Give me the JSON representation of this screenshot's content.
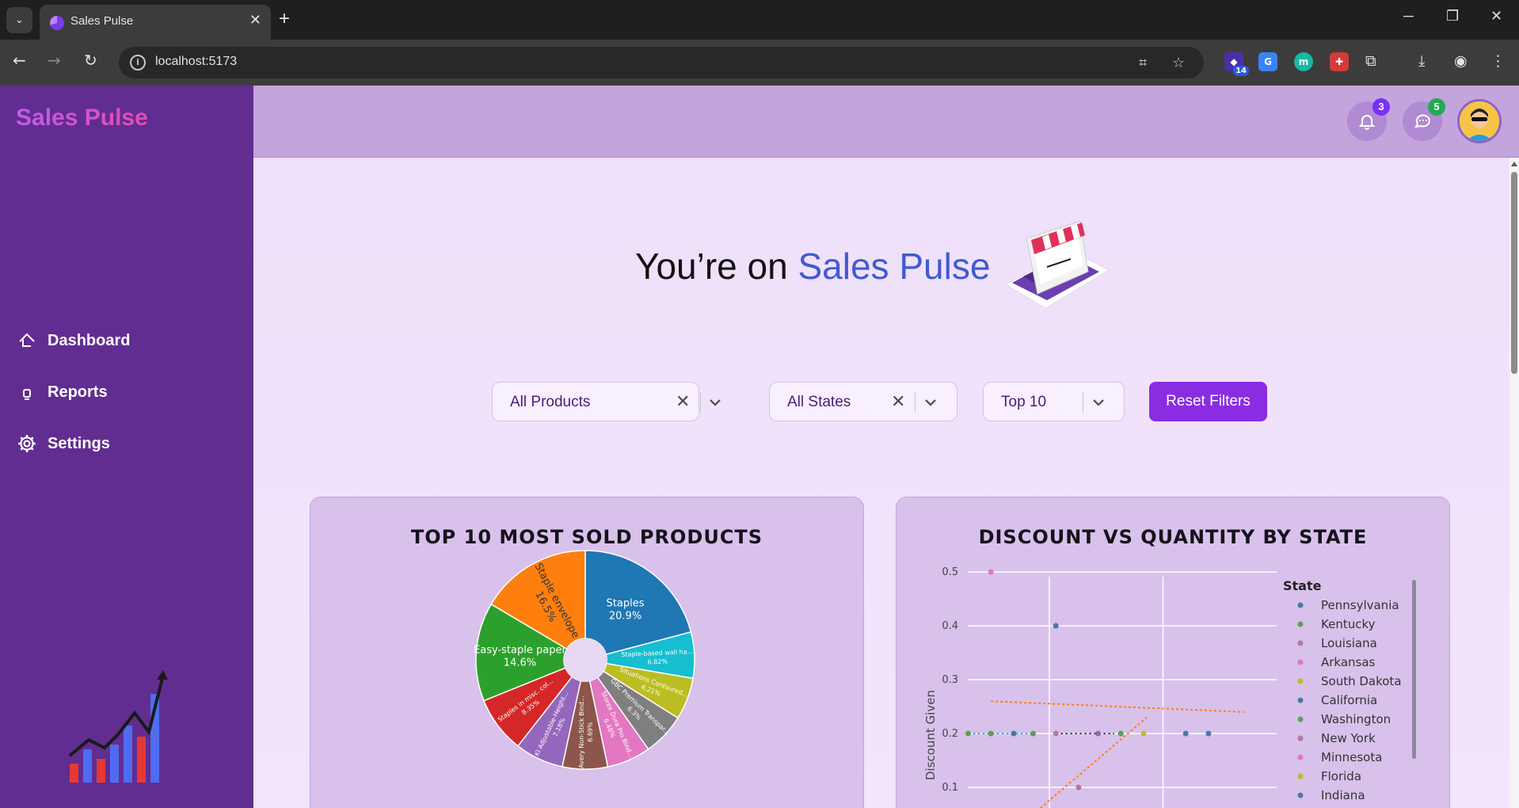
{
  "browser": {
    "tab_title": "Sales Pulse",
    "url": "localhost:5173",
    "ext_badge": "14",
    "new_tab": "+",
    "close": "✕"
  },
  "sidebar": {
    "brand": "Sales Pulse",
    "items": [
      {
        "label": "Dashboard",
        "icon": "home-icon"
      },
      {
        "label": "Reports",
        "icon": "report-icon"
      },
      {
        "label": "Settings",
        "icon": "gear-icon"
      }
    ]
  },
  "topbar": {
    "notifications_count": "3",
    "messages_count": "5"
  },
  "hero": {
    "prefix": "You’re on ",
    "accent": "Sales Pulse"
  },
  "filters": {
    "product": "All Products",
    "state": "All States",
    "top": "Top 10",
    "reset": "Reset Filters"
  },
  "colors": {
    "sidebar": "#612d91",
    "topbar": "#c4a4dc",
    "accent": "#8a2ce2",
    "hero_accent": "#3f5bd1"
  },
  "chart_data": [
    {
      "type": "pie",
      "title": "TOP 10 MOST SOLD PRODUCTS",
      "slices": [
        {
          "label": "Staples",
          "value": 20.9,
          "pct": "20.9%",
          "color": "#1f77b4"
        },
        {
          "label": "Staple-based wall ha...",
          "value": 6.82,
          "pct": "6.82%",
          "color": "#17becf"
        },
        {
          "label": "Situations Contoured...",
          "value": 6.21,
          "pct": "6.21%",
          "color": "#bcbd22"
        },
        {
          "label": "GBC Premium Transpar...",
          "value": 6.3,
          "pct": "6.3%",
          "color": "#7f7f7f"
        },
        {
          "label": "Storex Dura Pro Bind...",
          "value": 6.48,
          "pct": "6.48%",
          "color": "#e377c2"
        },
        {
          "label": "Avery Non-Stick Bind...",
          "value": 6.69,
          "pct": "6.69%",
          "color": "#8c564b"
        },
        {
          "label": "KI Adjustable-Height...",
          "value": 7.18,
          "pct": "7.18%",
          "color": "#9467bd"
        },
        {
          "label": "Staples in misc. col...",
          "value": 8.35,
          "pct": "8.35%",
          "color": "#d62728"
        },
        {
          "label": "Easy-staple paper",
          "value": 14.6,
          "pct": "14.6%",
          "color": "#2ca02c"
        },
        {
          "label": "Staple envelope",
          "value": 16.5,
          "pct": "16.5%",
          "color": "#ff7f0e"
        }
      ]
    },
    {
      "type": "scatter",
      "title": "DISCOUNT VS QUANTITY BY STATE",
      "ylabel": "Discount Given",
      "yticks": [
        "0.5",
        "0.4",
        "0.3",
        "0.2",
        "0.1"
      ],
      "ylim": [
        0.05,
        0.55
      ],
      "legend_title": "State",
      "legend_position": "right",
      "series": [
        {
          "name": "Pennsylvania",
          "color": "#4c78a8"
        },
        {
          "name": "Kentucky",
          "color": "#59a14f"
        },
        {
          "name": "Louisiana",
          "color": "#b279a2"
        },
        {
          "name": "Arkansas",
          "color": "#e377c2"
        },
        {
          "name": "South Dakota",
          "color": "#bcbd22"
        },
        {
          "name": "California",
          "color": "#4c78a8"
        },
        {
          "name": "Washington",
          "color": "#59a14f"
        },
        {
          "name": "New York",
          "color": "#b279a2"
        },
        {
          "name": "Minnesota",
          "color": "#e377c2"
        },
        {
          "name": "Florida",
          "color": "#bcbd22"
        },
        {
          "name": "Indiana",
          "color": "#4c78a8"
        }
      ],
      "points": [
        {
          "x": 0.05,
          "y": 0.2,
          "color": "#59a14f"
        },
        {
          "x": 0.12,
          "y": 0.2,
          "color": "#59a14f"
        },
        {
          "x": 0.19,
          "y": 0.2,
          "color": "#4c78a8"
        },
        {
          "x": 0.25,
          "y": 0.2,
          "color": "#59a14f"
        },
        {
          "x": 0.32,
          "y": 0.2,
          "color": "#b279a2"
        },
        {
          "x": 0.45,
          "y": 0.2,
          "color": "#8c6bb1"
        },
        {
          "x": 0.52,
          "y": 0.2,
          "color": "#59a14f"
        },
        {
          "x": 0.59,
          "y": 0.2,
          "color": "#bcbd22"
        },
        {
          "x": 0.72,
          "y": 0.2,
          "color": "#4c78a8"
        },
        {
          "x": 0.79,
          "y": 0.2,
          "color": "#4c78a8"
        },
        {
          "x": 0.12,
          "y": 0.5,
          "color": "#e377c2"
        },
        {
          "x": 0.32,
          "y": 0.4,
          "color": "#4c78a8"
        },
        {
          "x": 0.39,
          "y": 0.1,
          "color": "#b279a2"
        }
      ]
    }
  ]
}
